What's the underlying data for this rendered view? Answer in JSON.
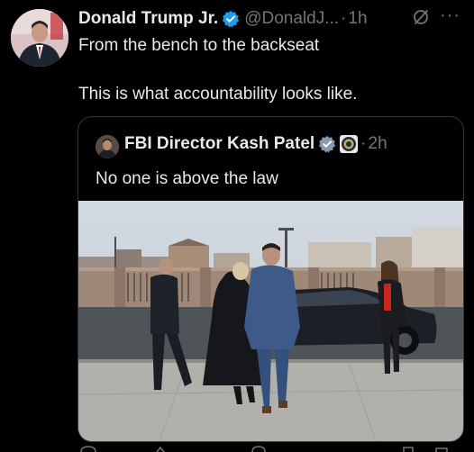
{
  "tweet": {
    "author_name": "Donald Trump Jr.",
    "handle": "@DonaldJ...",
    "separator": "·",
    "time": "1h",
    "line1": "From the bench to the backseat",
    "line2": "This is what accountability looks like.",
    "more_label": "···"
  },
  "quote": {
    "author_name": "FBI Director Kash Patel",
    "separator": "·",
    "time": "2h",
    "text": "No one is above the law"
  },
  "colors": {
    "background": "#000000",
    "text": "#e7e9ea",
    "muted": "#71767b",
    "verified": "#1d9bf0",
    "border": "#333639"
  },
  "icons": [
    "verified-badge-icon",
    "grok-icon",
    "more-icon",
    "fbi-seal-icon"
  ]
}
